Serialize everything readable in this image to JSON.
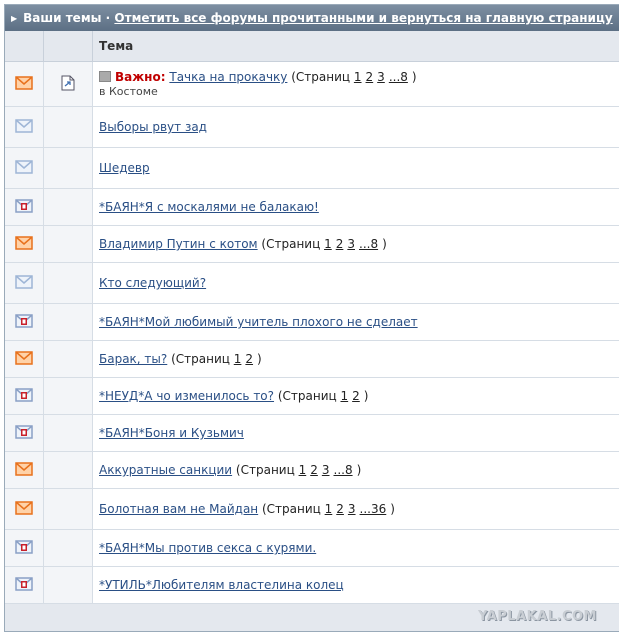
{
  "header": {
    "title": "Ваши темы",
    "separator": " · ",
    "mark_all_link": "Отметить все форумы прочитанными и вернуться на главную страницу"
  },
  "table": {
    "column_topic": "Тема"
  },
  "pages_prefix": "(Страниц",
  "pages_suffix": ")",
  "topics": [
    {
      "status": "hot",
      "pinned": true,
      "prefix": "Важно:",
      "title": "Тачка на прокачку",
      "pages": [
        "1",
        "2",
        "3",
        "...8"
      ],
      "sub": "в Костоме"
    },
    {
      "status": "read",
      "title": "Выборы рвут зад",
      "pages": []
    },
    {
      "status": "read",
      "title": "Шедевр",
      "pages": []
    },
    {
      "status": "locked",
      "title": "*БАЯН*Я с москалями не балакаю!",
      "pages": []
    },
    {
      "status": "hot",
      "title": "Владимир Путин с котом",
      "pages": [
        "1",
        "2",
        "3",
        "...8"
      ]
    },
    {
      "status": "read",
      "title": "Кто следующий?",
      "pages": []
    },
    {
      "status": "locked",
      "title": "*БАЯН*Мой любимый учитель плохого не сделает",
      "pages": []
    },
    {
      "status": "hot",
      "title": "Барак, ты?",
      "pages": [
        "1",
        "2"
      ]
    },
    {
      "status": "locked",
      "title": "*НЕУД*А чо изменилось то?",
      "pages": [
        "1",
        "2"
      ]
    },
    {
      "status": "locked",
      "title": "*БАЯН*Боня и Кузьмич",
      "pages": []
    },
    {
      "status": "hot",
      "title": "Аккуратные санкции",
      "pages": [
        "1",
        "2",
        "3",
        "...8"
      ]
    },
    {
      "status": "hot",
      "title": "Болотная вам не Майдан",
      "pages": [
        "1",
        "2",
        "3",
        "...36"
      ]
    },
    {
      "status": "locked",
      "title": "*БАЯН*Мы против секса с курями.",
      "pages": []
    },
    {
      "status": "locked",
      "title": "*УТИЛЬ*Любителям властелина колец",
      "pages": []
    }
  ],
  "footer": {
    "logo_text": "YAPLAKAL.COM"
  },
  "colors": {
    "hot": "#e8711c",
    "read": "#9eb5d6",
    "locked_env": "#8aa0c6",
    "locked_badge": "#c8202b"
  }
}
